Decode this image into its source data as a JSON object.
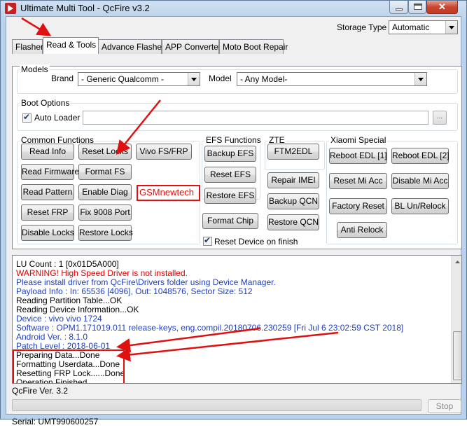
{
  "window": {
    "title": "Ultimate Multi Tool - QcFire v3.2"
  },
  "storage": {
    "label": "Storage Type",
    "value": "Automatic"
  },
  "tabs": [
    {
      "label": "Flasher"
    },
    {
      "label": "Read & Tools"
    },
    {
      "label": "Advance Flasher"
    },
    {
      "label": "APP Converter"
    },
    {
      "label": "Moto Boot Repair"
    }
  ],
  "models": {
    "group_title": "Models",
    "brand_label": "Brand",
    "brand_value": "- Generic Qualcomm -",
    "model_label": "Model",
    "model_value": "- Any Model-"
  },
  "boot_options": {
    "group_title": "Boot Options",
    "auto_loader_label": "Auto Loader",
    "browse_label": "..."
  },
  "common_functions": {
    "group_title": "Common Functions",
    "read_info": "Read Info",
    "reset_locks": "Reset Locks",
    "vivo_fs_frp": "Vivo FS/FRP",
    "read_firmware": "Read Firmware",
    "format_fs": "Format FS",
    "read_pattern": "Read Pattern",
    "enable_diag": "Enable Diag",
    "reset_frp": "Reset FRP",
    "fix_9008_port": "Fix 9008 Port",
    "disable_locks": "Disable Locks",
    "restore_locks": "Restore Locks"
  },
  "watermark": "GSMnewtech",
  "efs_functions": {
    "group_title": "EFS Functions",
    "backup_efs": "Backup EFS",
    "reset_efs": "Reset EFS",
    "restore_efs": "Restore EFS"
  },
  "zte": {
    "group_title": "ZTE",
    "ftm2edl": "FTM2EDL",
    "repair_imei": "Repair IMEI",
    "backup_qcn": "Backup QCN",
    "restore_qcn": "Restore QCN"
  },
  "format_chip": "Format Chip",
  "reset_after_finish": "Reset Device on finish",
  "xiaomi": {
    "group_title": "Xiaomi Special",
    "reboot_edl_1": "Reboot EDL [1]",
    "reboot_edl_2": "Reboot EDL [2]",
    "reset_mi_acc": "Reset Mi Acc",
    "disable_mi_acc": "Disable Mi Acc",
    "factory_reset": "Factory Reset",
    "bl_un_relock": "BL Un/Relock",
    "anti_relock": "Anti Relock"
  },
  "log": [
    {
      "text": "LU Count       : 1 [0x01D5A000]",
      "color": "#000000"
    },
    {
      "text": "WARNING! High Speed Driver is not installed.",
      "color": "#e00000"
    },
    {
      "text": "Please install driver from QcFire\\Drivers folder using Device Manager.",
      "color": "#1f3fbf"
    },
    {
      "text": "Payload Info  : In: 65536 [4096], Out: 1048576, Sector Size: 512",
      "color": "#1f3fbf"
    },
    {
      "text": "Reading Partition Table...OK",
      "color": "#000000"
    },
    {
      "text": "Reading Device Information...OK",
      "color": "#000000"
    },
    {
      "text": "Device           : vivo vivo 1724",
      "color": "#1f3fbf"
    },
    {
      "text": "Software       : OPM1.171019.011 release-keys, eng.compil.20180706.230259 [Fri Jul  6 23:02:59 CST 2018]",
      "color": "#1f3fbf"
    },
    {
      "text": "Android Ver.   : 8.1.0",
      "color": "#1f3fbf"
    },
    {
      "text": "Patch Level    : 2018-06-01",
      "color": "#1f3fbf"
    },
    {
      "text": "Preparing Data...Done",
      "color": "#000000"
    },
    {
      "text": "Formatting Userdata...Done",
      "color": "#000000"
    },
    {
      "text": "Resetting FRP Lock......Done",
      "color": "#000000"
    },
    {
      "text": "Operation Finished.",
      "color": "#000000"
    },
    {
      "text": "QcFire Ver. 3.2",
      "color": "#000000"
    }
  ],
  "stop_label": "Stop",
  "status": {
    "serial": "Serial: UMT990600257"
  }
}
